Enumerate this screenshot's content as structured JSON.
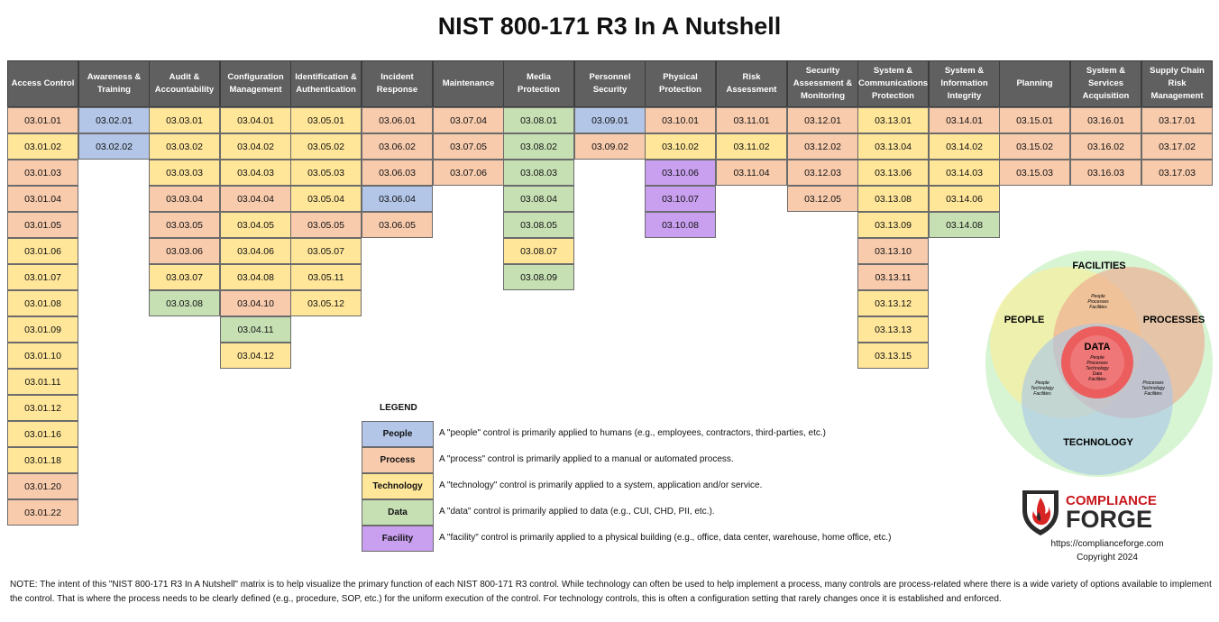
{
  "title": "NIST 800-171 R3 In A Nutshell",
  "columns": [
    {
      "header": "Access Control",
      "cells": [
        [
          "03.01.01",
          "process"
        ],
        [
          "03.01.02",
          "technology"
        ],
        [
          "03.01.03",
          "process"
        ],
        [
          "03.01.04",
          "process"
        ],
        [
          "03.01.05",
          "process"
        ],
        [
          "03.01.06",
          "technology"
        ],
        [
          "03.01.07",
          "technology"
        ],
        [
          "03.01.08",
          "technology"
        ],
        [
          "03.01.09",
          "technology"
        ],
        [
          "03.01.10",
          "technology"
        ],
        [
          "03.01.11",
          "technology"
        ],
        [
          "03.01.12",
          "technology"
        ],
        [
          "03.01.16",
          "technology"
        ],
        [
          "03.01.18",
          "technology"
        ],
        [
          "03.01.20",
          "process"
        ],
        [
          "03.01.22",
          "process"
        ]
      ]
    },
    {
      "header": "Awareness & Training",
      "cells": [
        [
          "03.02.01",
          "people"
        ],
        [
          "03.02.02",
          "people"
        ]
      ]
    },
    {
      "header": "Audit & Accountability",
      "cells": [
        [
          "03.03.01",
          "technology"
        ],
        [
          "03.03.02",
          "technology"
        ],
        [
          "03.03.03",
          "technology"
        ],
        [
          "03.03.04",
          "process"
        ],
        [
          "03.03.05",
          "process"
        ],
        [
          "03.03.06",
          "process"
        ],
        [
          "03.03.07",
          "technology"
        ],
        [
          "03.03.08",
          "data"
        ]
      ]
    },
    {
      "header": "Configuration Management",
      "cells": [
        [
          "03.04.01",
          "technology"
        ],
        [
          "03.04.02",
          "technology"
        ],
        [
          "03.04.03",
          "technology"
        ],
        [
          "03.04.04",
          "process"
        ],
        [
          "03.04.05",
          "technology"
        ],
        [
          "03.04.06",
          "technology"
        ],
        [
          "03.04.08",
          "technology"
        ],
        [
          "03.04.10",
          "process"
        ],
        [
          "03.04.11",
          "data"
        ],
        [
          "03.04.12",
          "technology"
        ]
      ]
    },
    {
      "header": "Identification & Authentication",
      "cells": [
        [
          "03.05.01",
          "technology"
        ],
        [
          "03.05.02",
          "technology"
        ],
        [
          "03.05.03",
          "technology"
        ],
        [
          "03.05.04",
          "technology"
        ],
        [
          "03.05.05",
          "process"
        ],
        [
          "03.05.07",
          "technology"
        ],
        [
          "03.05.11",
          "technology"
        ],
        [
          "03.05.12",
          "technology"
        ]
      ]
    },
    {
      "header": "Incident Response",
      "cells": [
        [
          "03.06.01",
          "process"
        ],
        [
          "03.06.02",
          "process"
        ],
        [
          "03.06.03",
          "process"
        ],
        [
          "03.06.04",
          "people"
        ],
        [
          "03.06.05",
          "process"
        ]
      ]
    },
    {
      "header": "Maintenance",
      "cells": [
        [
          "03.07.04",
          "process"
        ],
        [
          "03.07.05",
          "process"
        ],
        [
          "03.07.06",
          "process"
        ]
      ]
    },
    {
      "header": "Media Protection",
      "cells": [
        [
          "03.08.01",
          "data"
        ],
        [
          "03.08.02",
          "data"
        ],
        [
          "03.08.03",
          "data"
        ],
        [
          "03.08.04",
          "data"
        ],
        [
          "03.08.05",
          "data"
        ],
        [
          "03.08.07",
          "technology"
        ],
        [
          "03.08.09",
          "data"
        ]
      ]
    },
    {
      "header": "Personnel Security",
      "cells": [
        [
          "03.09.01",
          "people"
        ],
        [
          "03.09.02",
          "process"
        ]
      ]
    },
    {
      "header": "Physical Protection",
      "cells": [
        [
          "03.10.01",
          "process"
        ],
        [
          "03.10.02",
          "technology"
        ],
        [
          "03.10.06",
          "facility"
        ],
        [
          "03.10.07",
          "facility"
        ],
        [
          "03.10.08",
          "facility"
        ]
      ]
    },
    {
      "header": "Risk Assessment",
      "cells": [
        [
          "03.11.01",
          "process"
        ],
        [
          "03.11.02",
          "technology"
        ],
        [
          "03.11.04",
          "process"
        ]
      ]
    },
    {
      "header": "Security Assessment & Monitoring",
      "cells": [
        [
          "03.12.01",
          "process"
        ],
        [
          "03.12.02",
          "process"
        ],
        [
          "03.12.03",
          "process"
        ],
        [
          "03.12.05",
          "process"
        ]
      ]
    },
    {
      "header": "System & Communications Protection",
      "cells": [
        [
          "03.13.01",
          "technology"
        ],
        [
          "03.13.04",
          "technology"
        ],
        [
          "03.13.06",
          "technology"
        ],
        [
          "03.13.08",
          "technology"
        ],
        [
          "03.13.09",
          "technology"
        ],
        [
          "03.13.10",
          "process"
        ],
        [
          "03.13.11",
          "process"
        ],
        [
          "03.13.12",
          "technology"
        ],
        [
          "03.13.13",
          "technology"
        ],
        [
          "03.13.15",
          "technology"
        ]
      ]
    },
    {
      "header": "System & Information Integrity",
      "cells": [
        [
          "03.14.01",
          "process"
        ],
        [
          "03.14.02",
          "technology"
        ],
        [
          "03.14.03",
          "technology"
        ],
        [
          "03.14.06",
          "technology"
        ],
        [
          "03.14.08",
          "data"
        ]
      ]
    },
    {
      "header": "Planning",
      "cells": [
        [
          "03.15.01",
          "process"
        ],
        [
          "03.15.02",
          "process"
        ],
        [
          "03.15.03",
          "process"
        ]
      ]
    },
    {
      "header": "System & Services Acquisition",
      "cells": [
        [
          "03.16.01",
          "process"
        ],
        [
          "03.16.02",
          "process"
        ],
        [
          "03.16.03",
          "process"
        ]
      ]
    },
    {
      "header": "Supply Chain Risk Management",
      "cells": [
        [
          "03.17.01",
          "process"
        ],
        [
          "03.17.02",
          "process"
        ],
        [
          "03.17.03",
          "process"
        ]
      ]
    }
  ],
  "legend": {
    "title": "LEGEND",
    "items": [
      {
        "key": "people",
        "label": "People",
        "desc": "A \"people\" control is primarily applied to humans (e.g., employees, contractors, third-parties, etc.)"
      },
      {
        "key": "process",
        "label": "Process",
        "desc": "A \"process\" control is primarily applied to a manual or automated process."
      },
      {
        "key": "technology",
        "label": "Technology",
        "desc": "A \"technology\" control is primarily applied to a system, application and/or service."
      },
      {
        "key": "data",
        "label": "Data",
        "desc": "A \"data\" control is primarily applied to data (e.g., CUI, CHD, PII, etc.)."
      },
      {
        "key": "facility",
        "label": "Facility",
        "desc": "A \"facility\" control is primarily applied to a physical building (e.g., office, data center, warehouse, home office, etc.)"
      }
    ]
  },
  "venn": {
    "facilities": "FACILITIES",
    "people": "PEOPLE",
    "processes": "PROCESSES",
    "technology": "TECHNOLOGY",
    "data": "DATA",
    "pp_people": "People",
    "pp_processes": "Processes",
    "pp_facilities": "Facilities",
    "pt_people": "People",
    "pt_technology": "Technology",
    "pt_facilities": "Facilities",
    "prt_processes": "Processes",
    "prt_technology": "Technology",
    "prt_facilities": "Facilities",
    "d_people": "People",
    "d_processes": "Processes",
    "d_technology": "Technology",
    "d_data": "Data",
    "d_facilities": "Facilities"
  },
  "logo": {
    "line1": "COMPLIANCE",
    "line2": "FORGE"
  },
  "url": "https://complianceforge.com",
  "copyright": "Copyright 2024",
  "note": "NOTE: The intent of this \"NIST 800-171 R3 In A Nutshell\" matrix is to help visualize the primary function of each NIST 800-171 R3 control. While technology can often be used to help implement a process, many controls are process-related where there is a wide variety of options available to implement the control. That is where the process needs to be clearly defined (e.g., procedure, SOP, etc.) for the uniform execution of the control. For technology controls, this is often a configuration setting that rarely changes once it is established and enforced.",
  "colors": {
    "people": "#b3c6e7",
    "process": "#f8cbad",
    "technology": "#ffe699",
    "data": "#c6e0b4",
    "facility": "#c9a0f0",
    "header": "#606060"
  }
}
